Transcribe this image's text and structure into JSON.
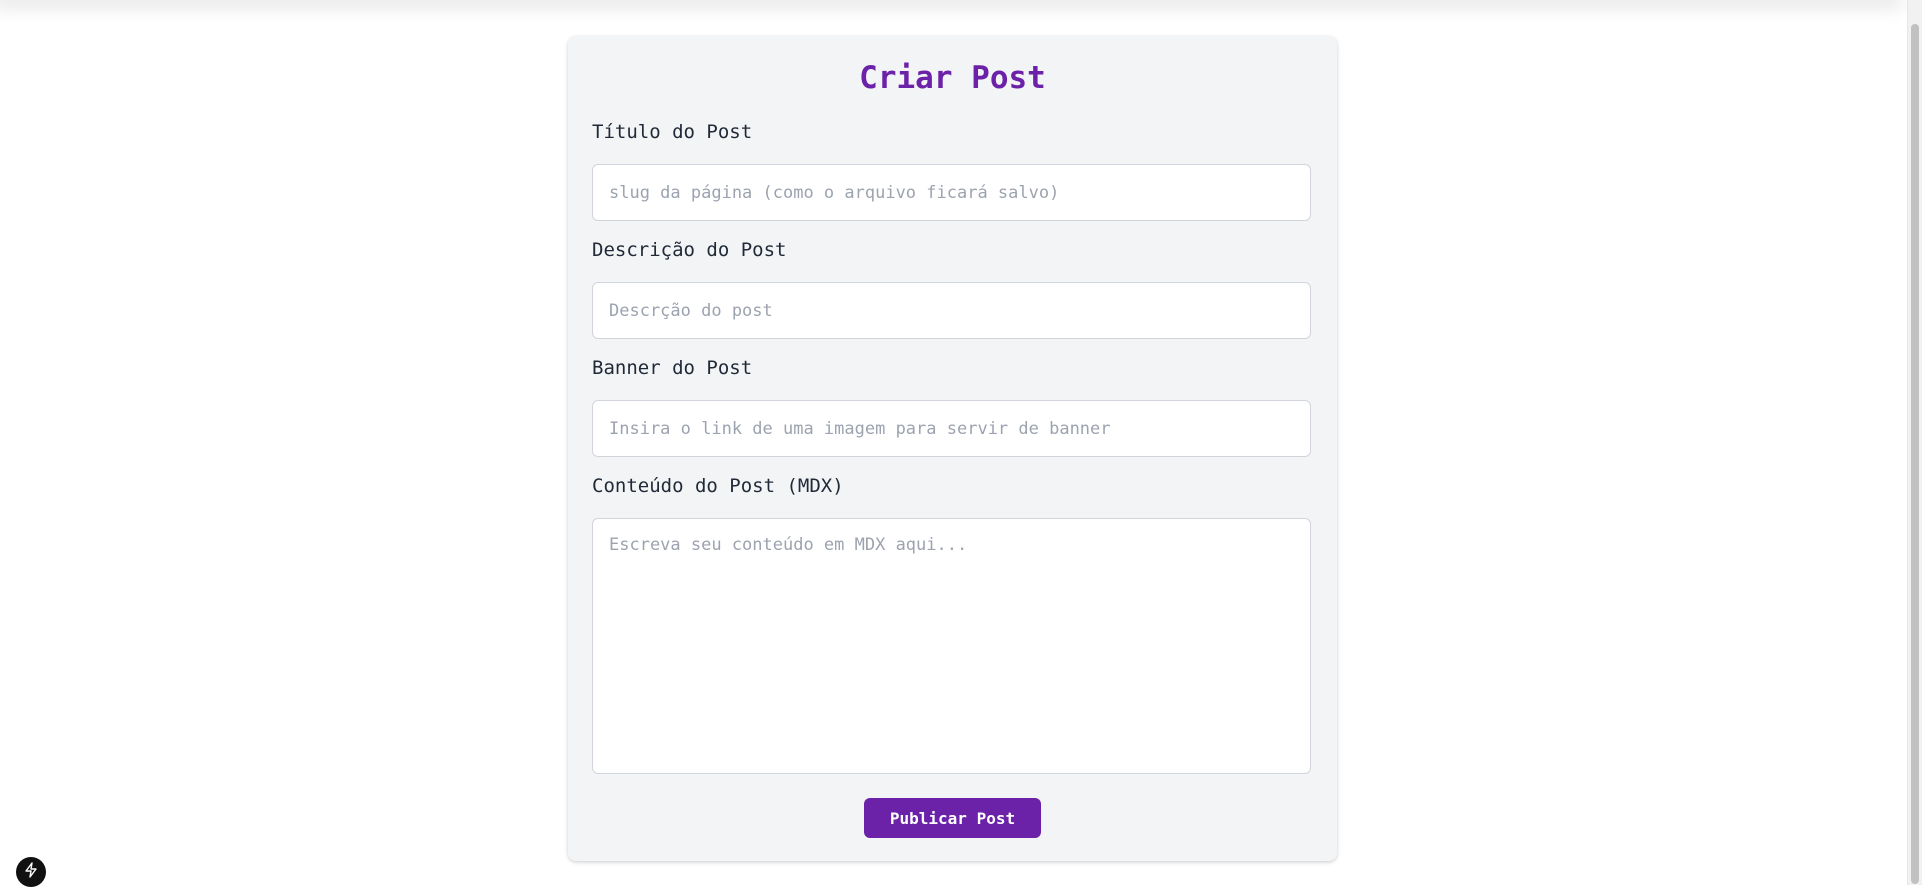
{
  "page": {
    "title": "Criar Post"
  },
  "form": {
    "fields": [
      {
        "label": "Título do Post",
        "placeholder": "slug da página (como o arquivo ficará salvo)",
        "value": ""
      },
      {
        "label": "Descrição do Post",
        "placeholder": "Descrção do post",
        "value": ""
      },
      {
        "label": "Banner do Post",
        "placeholder": "Insira o link de uma imagem para servir de banner",
        "value": ""
      },
      {
        "label": "Conteúdo do Post (MDX)",
        "placeholder": "Escreva seu conteúdo em MDX aqui...",
        "value": ""
      }
    ],
    "submit_label": "Publicar Post"
  },
  "icons": {
    "dev_badge": "lightning-bolt-icon"
  },
  "colors": {
    "accent": "#6b21a8",
    "card_bg": "#f3f4f6",
    "label_text": "#1f2937",
    "placeholder": "#9ca3af"
  }
}
